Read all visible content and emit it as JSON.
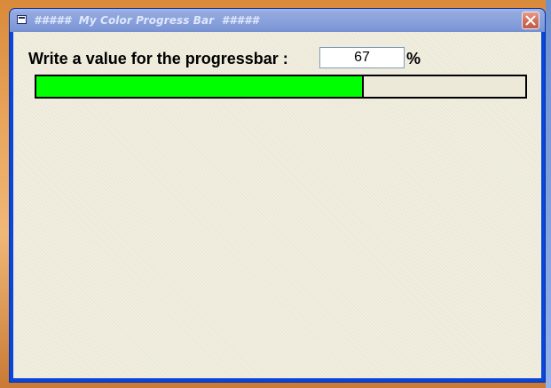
{
  "window": {
    "title": "#####  My Color Progress Bar  #####"
  },
  "form": {
    "prompt_label": "Write a value for the progressbar :",
    "value": "67",
    "percent_symbol": "%"
  },
  "progress": {
    "value_percent": 67,
    "fill_color": "#00ff00"
  },
  "icons": {
    "app": "application-window-icon",
    "close": "close-x-icon"
  }
}
